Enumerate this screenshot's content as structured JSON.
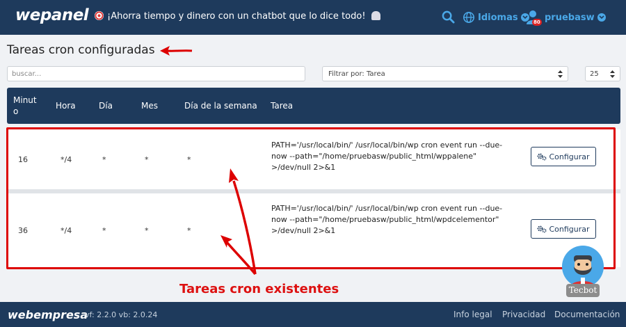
{
  "header": {
    "logo": "wepanel",
    "promo_text": "¡Ahorra tiempo y dinero con un chatbot que lo dice todo!",
    "languages_label": "Idiomas",
    "username": "pruebasw",
    "notification_count": "80"
  },
  "page": {
    "title": "Tareas cron configuradas"
  },
  "toolbar": {
    "search_placeholder": "buscar...",
    "filter_label": "Filtrar por: Tarea",
    "page_size": "25"
  },
  "table": {
    "columns": {
      "minute": "Minut o",
      "hour": "Hora",
      "day": "Día",
      "month": "Mes",
      "weekday": "Día de la semana",
      "task": "Tarea"
    },
    "rows": [
      {
        "minute": "16",
        "hour": "*/4",
        "day": "*",
        "month": "*",
        "weekday": "*",
        "task": "PATH='/usr/local/bin/' /usr/local/bin/wp cron event run --due-now --path=\"/home/pruebasw/public_html/wppalene\" >/dev/null 2>&1",
        "button": "Configurar"
      },
      {
        "minute": "36",
        "hour": "*/4",
        "day": "*",
        "month": "*",
        "weekday": "*",
        "task": "PATH='/usr/local/bin/' /usr/local/bin/wp cron event run --due-now --path=\"/home/pruebasw/public_html/wpdcelementor\" >/dev/null 2>&1",
        "button": "Configurar"
      }
    ]
  },
  "annotation": {
    "label": "Tareas cron existentes",
    "color": "#dd1111"
  },
  "chatbot": {
    "name": "Tecbot"
  },
  "footer": {
    "logo": "webempresa",
    "version": "vf: 2.2.0 vb: 2.0.24",
    "links": [
      "Info legal",
      "Privacidad",
      "Documentación"
    ]
  },
  "colors": {
    "primary": "#1e3a5c",
    "accent": "#4aa8e8",
    "highlight": "#dd0000"
  }
}
